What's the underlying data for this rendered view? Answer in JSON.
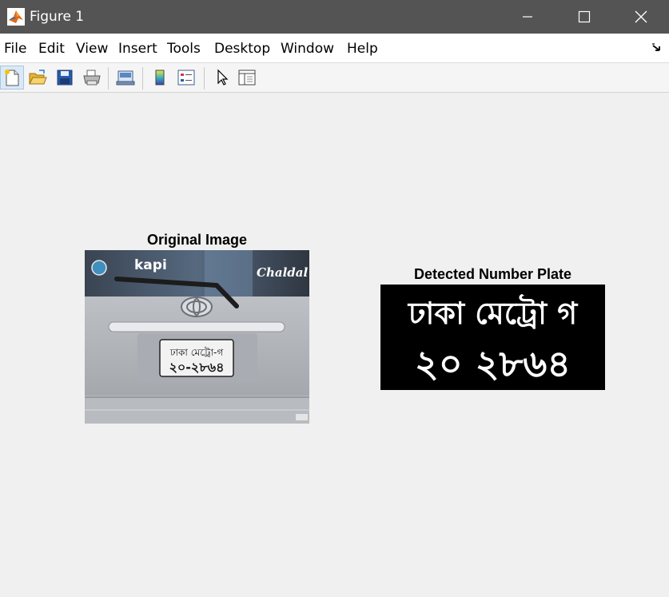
{
  "window": {
    "title": "Figure 1",
    "icon": "matlab-logo-icon"
  },
  "menu": {
    "items": [
      "File",
      "Edit",
      "View",
      "Insert",
      "Tools",
      "Desktop",
      "Window",
      "Help"
    ]
  },
  "toolbar": {
    "buttons": [
      "new-figure-icon",
      "open-file-icon",
      "save-icon",
      "print-icon",
      "link-plot-icon",
      "insert-colorbar-icon",
      "insert-legend-icon",
      "edit-plot-icon",
      "property-inspector-icon"
    ]
  },
  "axes": [
    {
      "title": "Original Image",
      "image": {
        "stickers": [
          "kapi",
          "Chaldal"
        ],
        "plate_line1": "ঢাকা মেট্রো-গ",
        "plate_line2": "২০-২৮৬৪"
      }
    },
    {
      "title": "Detected Number Plate",
      "image": {
        "line1": "ঢাকা মেট্রো গ",
        "line2": "২০ ২৮৬৪"
      }
    }
  ],
  "colors": {
    "titlebar": "#545454",
    "figure_background": "#f0f0f0",
    "plate_background": "#000000",
    "plate_text": "#ffffff"
  }
}
